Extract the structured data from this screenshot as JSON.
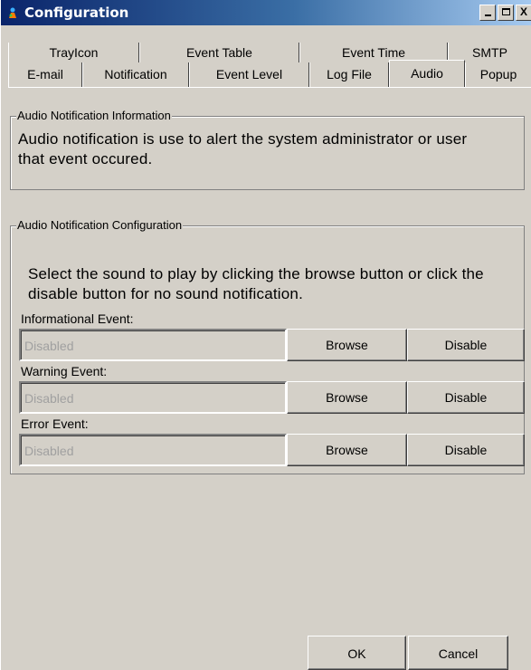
{
  "window": {
    "title": "Configuration",
    "buttons": {
      "minimize": "_",
      "maximize": "□",
      "close": "X"
    }
  },
  "tabs": {
    "row1": [
      "TrayIcon",
      "Event Table",
      "Event Time",
      "SMTP"
    ],
    "row2": [
      "E-mail",
      "Notification",
      "Event Level",
      "Log File",
      "Audio",
      "Popup"
    ],
    "active": "Audio"
  },
  "info_group": {
    "legend": "Audio Notification Information",
    "line1": "Audio notification is use to alert the system administrator or user",
    "line2": "that event occured."
  },
  "config_group": {
    "legend": "Audio Notification Configuration",
    "line1": "Select the sound to play by clicking the browse button or click the",
    "line2": "disable button for no sound notification.",
    "events": [
      {
        "label": "Informational Event:",
        "value": "Disabled",
        "browse": "Browse",
        "disable": "Disable"
      },
      {
        "label": "Warning Event:",
        "value": "Disabled",
        "browse": "Browse",
        "disable": "Disable"
      },
      {
        "label": "Error Event:",
        "value": "Disabled",
        "browse": "Browse",
        "disable": "Disable"
      }
    ]
  },
  "footer": {
    "ok": "OK",
    "cancel": "Cancel"
  }
}
